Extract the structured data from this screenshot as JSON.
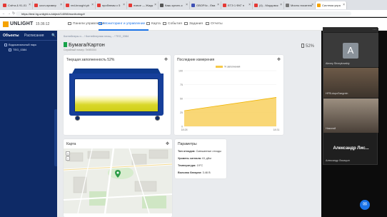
{
  "browser": {
    "tabs": [
      {
        "label": "Счёта & 91-01",
        "color": "#e53935"
      },
      {
        "label": "ozon-пример",
        "color": "#e53935"
      },
      {
        "label": "red-brought.ph",
        "color": "#e53935"
      },
      {
        "label": "проблемы с 5",
        "color": "#e53935"
      },
      {
        "label": "новое — Жидк",
        "color": "#e53935"
      },
      {
        "label": "Какь купить к",
        "color": "#555555"
      },
      {
        "label": "GBOР4с - Ева",
        "color": "#3f51b5"
      },
      {
        "label": "ЕГЭ 1 ФКГ п",
        "color": "#e53935"
      },
      {
        "label": "(4) - Мордовск",
        "color": "#e53935"
      },
      {
        "label": "Мисты писатель",
        "color": "#777777"
      },
      {
        "label": "Система упра",
        "color": "#f5a300"
      }
    ],
    "url": "https://test.hg.unlight.ru/object/14098/monitoring/#"
  },
  "header": {
    "brand": "UNLIGHT",
    "clock": "15:36:12",
    "menu": [
      {
        "label": "Панели управления",
        "active": false
      },
      {
        "label": "Мониторинг и управление",
        "active": true
      },
      {
        "label": "Карта",
        "active": false
      },
      {
        "label": "События",
        "active": false
      },
      {
        "label": "Задания",
        "active": false
      },
      {
        "label": "Отчеты",
        "active": false
      }
    ]
  },
  "sidebar": {
    "tab_objects": "Объекты",
    "tab_schedule": "Расписания",
    "items": [
      {
        "label": "Водоканальный парк"
      },
      {
        "label": "TEG_0384"
      }
    ]
  },
  "page": {
    "breadcrumb": "Контейнеры и... / Контейнерная площ... / TEG_0384",
    "title": "Бумага/Картон",
    "subtitle": "Серийный номер: TeMB004",
    "fill_percent": "52%"
  },
  "cards": {
    "fill": {
      "title": "Текущая заполненность 52%",
      "level": 0.52
    },
    "measurements": {
      "title": "Последние измерения"
    },
    "map": {
      "title": "Карта",
      "zoom_in": "+",
      "zoom_out": "−"
    },
    "params": {
      "title": "Параметры",
      "rows": [
        {
          "label": "Тип отходов:",
          "value": "Смешанные отходы"
        },
        {
          "label": "Уровень сигнала:",
          "value": "61 дБм"
        },
        {
          "label": "Температура:",
          "value": "19°С"
        },
        {
          "label": "Вольтаж батареи:",
          "value": "3.46 В"
        }
      ]
    }
  },
  "chart_data": {
    "type": "area",
    "title": "Последние измерения",
    "legend": [
      "% заполнения"
    ],
    "legend_position": "top",
    "x": [
      "18:28",
      "18:31"
    ],
    "series": [
      {
        "name": "% заполнения",
        "values": [
          28,
          52
        ]
      }
    ],
    "ylim": [
      0,
      100
    ],
    "yticks": [
      0,
      25,
      50,
      75,
      100
    ],
    "color": "#f7c948"
  },
  "video_call": {
    "tiles": [
      {
        "name": "Alexey Shveykovskiy",
        "avatar_letter": "A"
      },
      {
        "name": "HFSLdopoSsegrein"
      },
      {
        "name": "Николай"
      }
    ],
    "main_speaker": "Александр Лис...",
    "footer": "Александр Лисицын"
  }
}
